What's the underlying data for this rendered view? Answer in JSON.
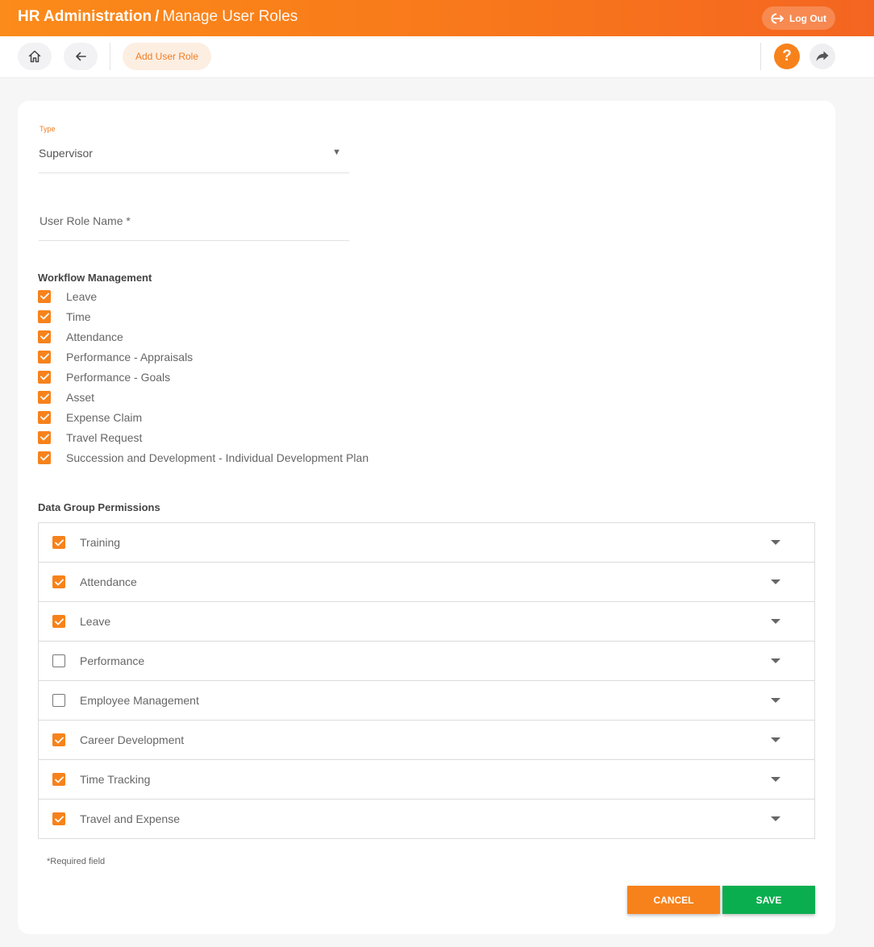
{
  "colors": {
    "accent": "#f7821b",
    "save": "#0bae4f"
  },
  "header": {
    "title_main": "HR Administration",
    "title_sep": "/",
    "title_sub": "Manage User Roles",
    "logout_label": "Log Out",
    "logout_icon": "logout-icon"
  },
  "toolbar": {
    "home_icon": "home-icon",
    "back_icon": "arrow-left-icon",
    "add_label": "Add User Role",
    "help_label": "?",
    "share_icon": "share-icon"
  },
  "form": {
    "type_label": "Type",
    "type_value": "Supervisor",
    "name_placeholder": "User Role Name *",
    "name_value": ""
  },
  "workflow": {
    "title": "Workflow Management",
    "items": [
      {
        "label": "Leave",
        "checked": true
      },
      {
        "label": "Time",
        "checked": true
      },
      {
        "label": "Attendance",
        "checked": true
      },
      {
        "label": "Performance - Appraisals",
        "checked": true
      },
      {
        "label": "Performance - Goals",
        "checked": true
      },
      {
        "label": "Asset",
        "checked": true
      },
      {
        "label": "Expense Claim",
        "checked": true
      },
      {
        "label": "Travel Request",
        "checked": true
      },
      {
        "label": "Succession and Development - Individual Development Plan",
        "checked": true
      }
    ]
  },
  "data_groups": {
    "title": "Data Group Permissions",
    "rows": [
      {
        "label": "Training",
        "checked": true
      },
      {
        "label": "Attendance",
        "checked": true
      },
      {
        "label": "Leave",
        "checked": true
      },
      {
        "label": "Performance",
        "checked": false
      },
      {
        "label": "Employee Management",
        "checked": false
      },
      {
        "label": "Career Development",
        "checked": true
      },
      {
        "label": "Time Tracking",
        "checked": true
      },
      {
        "label": "Travel and Expense",
        "checked": true
      }
    ]
  },
  "footer": {
    "required_note": "*Required field",
    "cancel_label": "CANCEL",
    "save_label": "SAVE"
  }
}
